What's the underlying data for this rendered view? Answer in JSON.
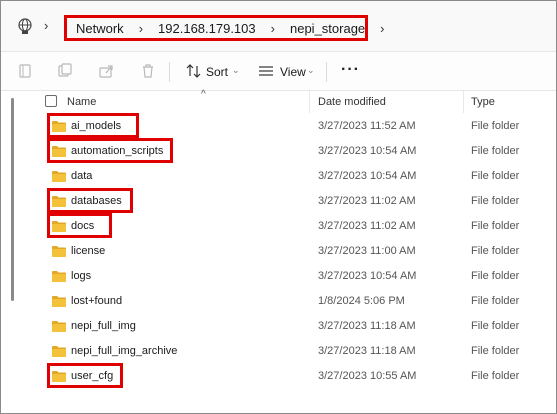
{
  "breadcrumb": {
    "items": [
      "Network",
      "192.168.179.103",
      "nepi_storage"
    ]
  },
  "toolbar": {
    "sort_label": "Sort",
    "view_label": "View",
    "more_label": "···"
  },
  "columns": {
    "name": "Name",
    "date": "Date modified",
    "type": "Type"
  },
  "rows": [
    {
      "name": "ai_models",
      "date": "3/27/2023 11:52 AM",
      "type": "File folder",
      "highlighted": true
    },
    {
      "name": "automation_scripts",
      "date": "3/27/2023 10:54 AM",
      "type": "File folder",
      "highlighted": true
    },
    {
      "name": "data",
      "date": "3/27/2023 10:54 AM",
      "type": "File folder",
      "highlighted": false
    },
    {
      "name": "databases",
      "date": "3/27/2023 11:02 AM",
      "type": "File folder",
      "highlighted": true
    },
    {
      "name": "docs",
      "date": "3/27/2023 11:02 AM",
      "type": "File folder",
      "highlighted": true
    },
    {
      "name": "license",
      "date": "3/27/2023 11:00 AM",
      "type": "File folder",
      "highlighted": false
    },
    {
      "name": "logs",
      "date": "3/27/2023 10:54 AM",
      "type": "File folder",
      "highlighted": false
    },
    {
      "name": "lost+found",
      "date": "1/8/2024 5:06 PM",
      "type": "File folder",
      "highlighted": false
    },
    {
      "name": "nepi_full_img",
      "date": "3/27/2023 11:18 AM",
      "type": "File folder",
      "highlighted": false
    },
    {
      "name": "nepi_full_img_archive",
      "date": "3/27/2023 11:18 AM",
      "type": "File folder",
      "highlighted": false
    },
    {
      "name": "user_cfg",
      "date": "3/27/2023 10:55 AM",
      "type": "File folder",
      "highlighted": true
    }
  ],
  "colors": {
    "highlight": "#e00000",
    "folder": "#f3c13a"
  }
}
